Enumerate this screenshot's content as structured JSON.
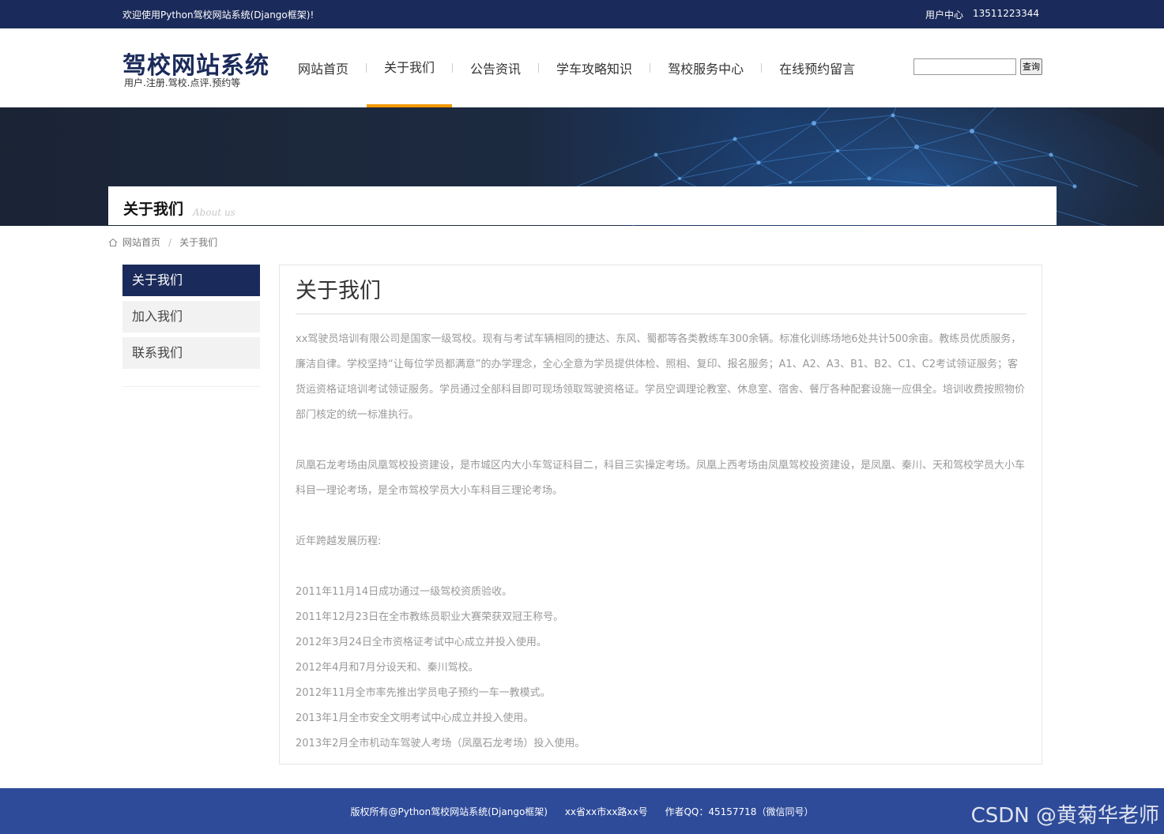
{
  "topbar": {
    "welcome": "欢迎使用Python驾校网站系统(Django框架)!",
    "user_center": "用户中心",
    "phone": "13511223344"
  },
  "header": {
    "title": "驾校网站系统",
    "subtitle": "用户.注册.驾校.点评.预约等",
    "nav": [
      {
        "label": "网站首页"
      },
      {
        "label": "关于我们"
      },
      {
        "label": "公告资讯"
      },
      {
        "label": "学车攻略知识"
      },
      {
        "label": "驾校服务中心"
      },
      {
        "label": "在线预约留言"
      }
    ],
    "search_button": "查询"
  },
  "page_title": {
    "zh": "关于我们",
    "en": "About us"
  },
  "breadcrumb": {
    "home": "网站首页",
    "separator": "/",
    "current": "关于我们"
  },
  "sidebar": {
    "items": [
      {
        "label": "关于我们"
      },
      {
        "label": "加入我们"
      },
      {
        "label": "联系我们"
      }
    ]
  },
  "content": {
    "heading": "关于我们",
    "p1": "xx驾驶员培训有限公司是国家一级驾校。现有与考试车辆相同的捷达、东风、蜀都等各类教练车300余辆。标准化训练场地6处共计500余亩。教练员优质服务，廉洁自律。学校坚持“让每位学员都满意”的办学理念，全心全意为学员提供体检、照相、复印、报名服务；A1、A2、A3、B1、B2、C1、C2考试领证服务；客货运资格证培训考试领证服务。学员通过全部科目即可现场领取驾驶资格证。学员空调理论教室、休息室、宿舍、餐厅各种配套设施一应俱全。培训收费按照物价部门核定的统一标准执行。",
    "p2": "凤凰石龙考场由凤凰驾校投资建设，是市城区内大小车驾证科目二，科目三实操定考场。凤凰上西考场由凤凰驾校投资建设，是凤凰、秦川、天和驾校学员大小车科目一理论考场，是全市驾校学员大小车科目三理论考场。",
    "history_title": "近年跨越发展历程:",
    "history": [
      "2011年11月14日成功通过一级驾校资质验收。",
      "2011年12月23日在全市教练员职业大赛荣获双冠王称号。",
      "2012年3月24日全市资格证考试中心成立并投入使用。",
      "2012年4月和7月分设天和、秦川驾校。",
      "2012年11月全市率先推出学员电子预约一车一教模式。",
      "2013年1月全市安全文明考试中心成立并投入使用。",
      "2013年2月全市机动车驾驶人考场（凤凰石龙考场）投入使用。"
    ]
  },
  "footer": {
    "copyright": "版权所有@Python驾校网站系统(Django框架)",
    "address": "xx省xx市xx路xx号",
    "author": "作者QQ：45157718（微信同号）"
  },
  "watermark": "CSDN @黄菊华老师",
  "colors": {
    "navy": "#1a2a5a",
    "accent": "#f39800",
    "footer": "#2e4b9a"
  }
}
